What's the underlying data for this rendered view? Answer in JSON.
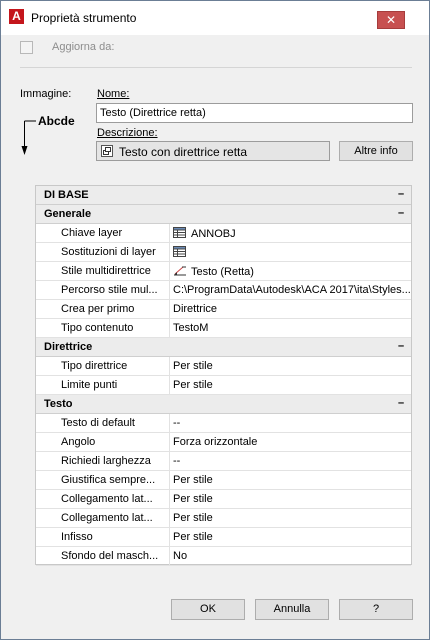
{
  "window": {
    "title": "Proprietà strumento"
  },
  "aggiorna": {
    "label": "Aggiorna da:",
    "checked": false
  },
  "immagine": {
    "label": "Immagine:",
    "preview_text": "Abcde"
  },
  "nome": {
    "label": "Nome:",
    "value": "Testo (Direttrice retta)"
  },
  "descrizione": {
    "label": "Descrizione:",
    "value": "Testo con direttrice retta"
  },
  "buttons": {
    "altre_info": "Altre info",
    "ok": "OK",
    "annulla": "Annulla",
    "help": "?"
  },
  "grid": {
    "rows": [
      {
        "type": "category",
        "label": "DI BASE",
        "toggle": "–"
      },
      {
        "type": "category",
        "label": "Generale",
        "toggle": "–"
      },
      {
        "type": "property",
        "name": "Chiave layer",
        "value": "ANNOBJ",
        "icon": "layer-table-icon"
      },
      {
        "type": "property",
        "name": "Sostituzioni di layer",
        "value": "",
        "icon": "layer-table-icon"
      },
      {
        "type": "property",
        "name": "Stile multidirettrice",
        "value": "Testo (Retta)",
        "icon": "multileader-icon"
      },
      {
        "type": "property",
        "name": "Percorso stile mul...",
        "value": "C:\\ProgramData\\Autodesk\\ACA 2017\\ita\\Styles..."
      },
      {
        "type": "property",
        "name": "Crea per primo",
        "value": "Direttrice"
      },
      {
        "type": "property",
        "name": "Tipo contenuto",
        "value": "TestoM"
      },
      {
        "type": "category",
        "label": "Direttrice",
        "toggle": "–"
      },
      {
        "type": "property",
        "name": "Tipo direttrice",
        "value": "Per stile"
      },
      {
        "type": "property",
        "name": "Limite punti",
        "value": "Per stile"
      },
      {
        "type": "category",
        "label": "Testo",
        "toggle": "–"
      },
      {
        "type": "property",
        "name": "Testo di default",
        "value": "--"
      },
      {
        "type": "property",
        "name": "Angolo",
        "value": "Forza orizzontale"
      },
      {
        "type": "property",
        "name": "Richiedi larghezza",
        "value": "--"
      },
      {
        "type": "property",
        "name": "Giustifica sempre...",
        "value": "Per stile"
      },
      {
        "type": "property",
        "name": "Collegamento lat...",
        "value": "Per stile"
      },
      {
        "type": "property",
        "name": "Collegamento lat...",
        "value": "Per stile"
      },
      {
        "type": "property",
        "name": "Infisso",
        "value": "Per stile"
      },
      {
        "type": "property",
        "name": "Sfondo del masch...",
        "value": "No"
      }
    ]
  },
  "colors": {
    "close_button": "#c75050",
    "app_icon": "#c4161c"
  }
}
